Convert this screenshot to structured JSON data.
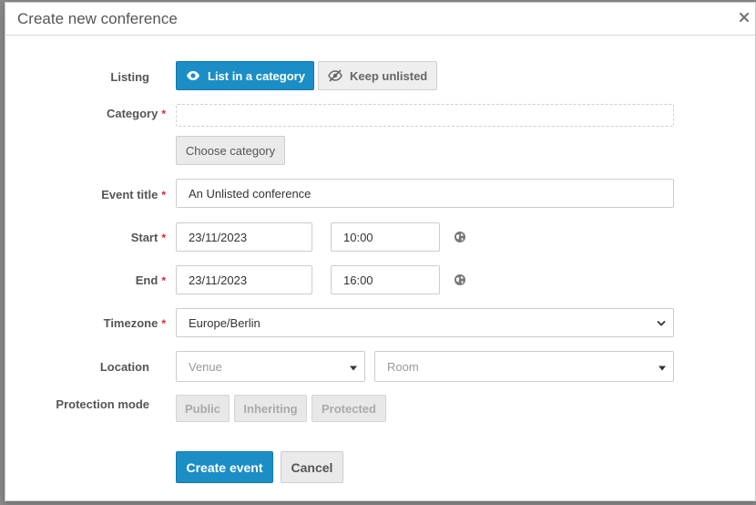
{
  "dialog": {
    "title": "Create new conference"
  },
  "listing": {
    "label": "Listing",
    "options": [
      {
        "label": "List in a category",
        "icon": "eye-icon",
        "active": true
      },
      {
        "label": "Keep unlisted",
        "icon": "eye-slash-icon",
        "active": false
      }
    ]
  },
  "category": {
    "label": "Category",
    "required": "*",
    "choose_button": "Choose category"
  },
  "event_title": {
    "label": "Event title",
    "required": "*",
    "value": "An Unlisted conference"
  },
  "start": {
    "label": "Start",
    "required": "*",
    "date": "23/11/2023",
    "time": "10:00"
  },
  "end": {
    "label": "End",
    "required": "*",
    "date": "23/11/2023",
    "time": "16:00"
  },
  "timezone": {
    "label": "Timezone",
    "required": "*",
    "value": "Europe/Berlin"
  },
  "location": {
    "label": "Location",
    "venue_placeholder": "Venue",
    "room_placeholder": "Room"
  },
  "protection": {
    "label": "Protection mode",
    "options": [
      "Public",
      "Inheriting",
      "Protected"
    ]
  },
  "actions": {
    "create": "Create event",
    "cancel": "Cancel"
  },
  "colors": {
    "primary": "#1c8ec6",
    "required": "#d9262c"
  }
}
